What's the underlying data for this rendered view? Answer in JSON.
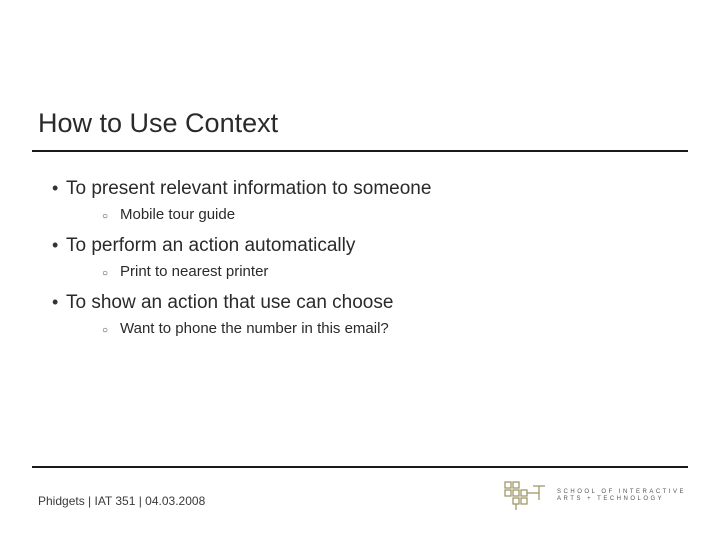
{
  "title": "How to Use Context",
  "bullets": [
    {
      "text": "To present relevant information to someone",
      "sub": [
        "Mobile tour guide"
      ]
    },
    {
      "text": "To perform an action automatically",
      "sub": [
        "Print to nearest printer"
      ]
    },
    {
      "text": "To show an action that use can choose",
      "sub": [
        "Want to phone the number in this email?"
      ]
    }
  ],
  "footer": "Phidgets  |  IAT 351  |  04.03.2008",
  "logo": {
    "line1": "SCHOOL OF INTERACTIVE",
    "line2": "ARTS + TECHNOLOGY"
  }
}
